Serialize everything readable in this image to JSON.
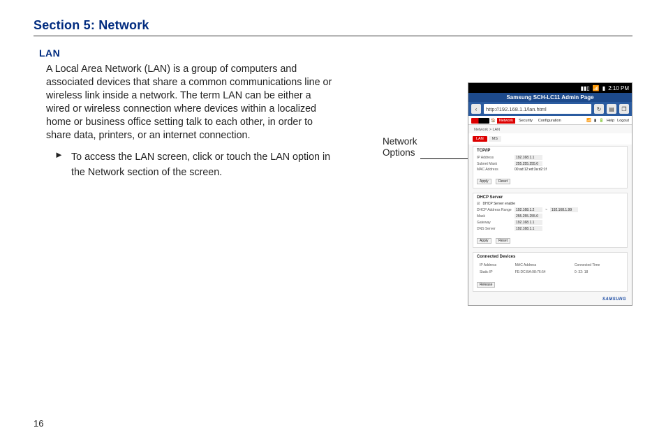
{
  "section_title": "Section 5: Network",
  "subhead": "LAN",
  "para1": "A Local Area Network (LAN) is a group of computers and associated devices that share a common communications line or wireless link inside a network. The term LAN can be either a wired or wireless connection where devices within a localized home or business office setting talk to each other, in order to share data, printers, or an internet connection.",
  "bullet_marker": "►",
  "bullet_text": "To access the LAN screen, click or touch the LAN option in the Network section of the screen.",
  "callout_label": "Network\nOptions",
  "page_number": "16",
  "device": {
    "status_time": "2:10 PM",
    "titlebar": "Samsung SCH-LC11 Admin Page",
    "back_glyph": "‹",
    "url": "http://192.168.1.1/lan.html",
    "refresh_glyph": "↻",
    "tabs": {
      "network": "Network",
      "security": "Security",
      "config": "Configuration"
    },
    "topright": {
      "help": "Help",
      "logout": "Logout"
    },
    "options": {
      "lan": "LAN",
      "ms": "MS"
    },
    "breadcrumb": "Network > LAN",
    "tcpip": {
      "title": "TCP/IP",
      "ip_label": "IP Address",
      "ip_value": "192.168.1.1",
      "subnet_label": "Subnet Mask",
      "subnet_value": "255.255.255.0",
      "mac_label": "MAC Address",
      "mac_value": "00:ad:12:ed:3a:d2:1f"
    },
    "dhcp": {
      "title": "DHCP Server",
      "enable_label": "DHCP Server enable",
      "range_label": "DHCP Address Range",
      "range_from": "192.168.1.2",
      "range_sep": "~",
      "range_to": "192.168.1.99",
      "mask_label": "Mask",
      "mask_value": "255.255.255.0",
      "gateway_label": "Gateway",
      "gateway_value": "192.168.1.1",
      "dns_label": "DNS Server",
      "dns_value": "192.168.1.1"
    },
    "connected": {
      "title": "Connected Devices",
      "col_ip": "IP Address",
      "col_mac": "MAC Address",
      "col_time": "Connected Time",
      "row_ip": "Static IP",
      "row_mac": "FE:DC:BA:98:76:54",
      "row_time": "0: 32: 18",
      "release": "Release"
    },
    "apply": "Apply",
    "reset": "Reset",
    "brand": "SAMSUNG"
  }
}
